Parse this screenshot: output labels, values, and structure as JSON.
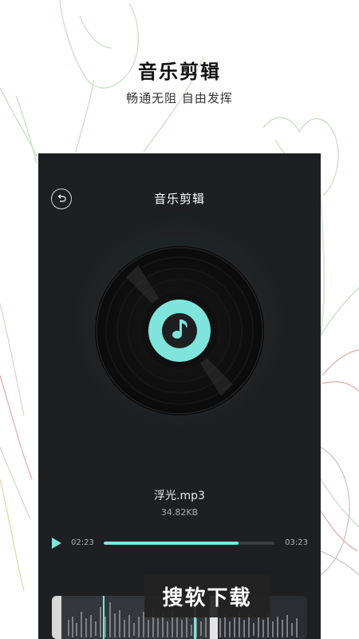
{
  "promo": {
    "title": "音乐剪辑",
    "subtitle": "畅通无阻 自由发挥"
  },
  "screen": {
    "title": "音乐剪辑",
    "back_icon": "back-arrow-icon",
    "disc_icon": "music-note-icon"
  },
  "track": {
    "name": "浮光.mp3",
    "size": "34.82KB"
  },
  "player": {
    "current_time": "02:23",
    "total_time": "03:23",
    "progress": 0.79
  },
  "watermark": "搜软下载",
  "colors": {
    "accent": "#7fe5dc",
    "screen_bg": "#1d1f22",
    "line_art": "#bfe3bd"
  }
}
